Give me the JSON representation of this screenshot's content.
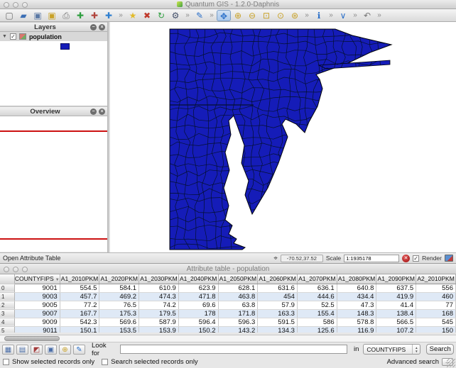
{
  "window": {
    "title": "Quantum GIS - 1.2.0-Daphnis"
  },
  "main_toolbar": {
    "tools": [
      {
        "name": "new-project",
        "glyph": "▢",
        "color": "#6b6b6b"
      },
      {
        "name": "open-project",
        "glyph": "▰",
        "color": "#3b6fb5"
      },
      {
        "name": "save-project",
        "glyph": "▣",
        "color": "#5b79a5"
      },
      {
        "name": "save-project-as",
        "glyph": "▣",
        "color": "#c9a227"
      },
      {
        "name": "print-composer",
        "glyph": "⎙",
        "color": "#777777"
      },
      {
        "name": "add-vector-layer",
        "glyph": "✚",
        "color": "#2e9e3f"
      },
      {
        "name": "add-raster-layer",
        "glyph": "✚",
        "color": "#b0443c"
      },
      {
        "name": "new-vector-layer",
        "glyph": "✚",
        "color": "#2f7fd0"
      },
      {
        "name": "overflow",
        "glyph": "»",
        "color": "#8a8a8a"
      },
      {
        "name": "new-bookmark",
        "glyph": "★",
        "color": "#e2bb2a"
      },
      {
        "name": "remove-layer",
        "glyph": "✖",
        "color": "#c0392b"
      },
      {
        "name": "add-to-overview",
        "glyph": "↻",
        "color": "#2e9e3f"
      },
      {
        "name": "options",
        "glyph": "⚙",
        "color": "#44506b"
      },
      {
        "name": "overflow",
        "glyph": "»",
        "color": "#8a8a8a"
      },
      {
        "name": "edit-pencil",
        "glyph": "✎",
        "color": "#2a6fc9"
      },
      {
        "name": "overflow",
        "glyph": "»",
        "color": "#8a8a8a"
      },
      {
        "name": "pan-map",
        "glyph": "✥",
        "color": "#2a6fc9",
        "active": true
      },
      {
        "name": "zoom-in",
        "glyph": "⊕",
        "color": "#c9a227"
      },
      {
        "name": "zoom-out",
        "glyph": "⊖",
        "color": "#c9a227"
      },
      {
        "name": "zoom-to-selection",
        "glyph": "⊡",
        "color": "#c9a227"
      },
      {
        "name": "zoom-last",
        "glyph": "⊙",
        "color": "#c9a227"
      },
      {
        "name": "zoom-full",
        "glyph": "⊛",
        "color": "#c9a227"
      },
      {
        "name": "overflow",
        "glyph": "»",
        "color": "#8a8a8a"
      },
      {
        "name": "identify-features",
        "glyph": "ℹ",
        "color": "#2a6fc9"
      },
      {
        "name": "overflow",
        "glyph": "»",
        "color": "#8a8a8a"
      },
      {
        "name": "measure-line",
        "glyph": "∨",
        "color": "#2a6fc9"
      },
      {
        "name": "overflow",
        "glyph": "»",
        "color": "#8a8a8a"
      },
      {
        "name": "undo",
        "glyph": "↶",
        "color": "#777777"
      },
      {
        "name": "overflow",
        "glyph": "»",
        "color": "#8a8a8a"
      }
    ]
  },
  "layers_panel": {
    "title": "Layers",
    "layer": {
      "name": "population",
      "checked": "✓"
    }
  },
  "overview_panel": {
    "title": "Overview"
  },
  "map": {
    "fill_color": "#151cb8",
    "outline_color": "#000208",
    "county_line_color": "#04102e"
  },
  "status_bar": {
    "hint": "Open Attribute Table",
    "coordinates": "-70.52,37.52",
    "scale_label": "Scale",
    "scale_value": "1:1935178",
    "render_label": "Render",
    "render_checked": "✓"
  },
  "attribute_table": {
    "title": "Attribute table - population",
    "sort_column": "COUNTYFIPS",
    "columns": [
      "COUNTYFIPS",
      "A1_2010PKM",
      "A1_2020PKM",
      "A1_2030PKM",
      "A1_2040PKM",
      "A1_2050PKM",
      "A1_2060PKM",
      "A1_2070PKM",
      "A1_2080PKM",
      "A1_2090PKM",
      "A2_2010PKM"
    ],
    "rows": [
      [
        "9001",
        "554.5",
        "584.1",
        "610.9",
        "623.9",
        "628.1",
        "631.6",
        "636.1",
        "640.8",
        "637.5",
        "556"
      ],
      [
        "9003",
        "457.7",
        "469.2",
        "474.3",
        "471.8",
        "463.8",
        "454",
        "444.6",
        "434.4",
        "419.9",
        "460"
      ],
      [
        "9005",
        "77.2",
        "76.5",
        "74.2",
        "69.6",
        "63.8",
        "57.9",
        "52.5",
        "47.3",
        "41.4",
        "77"
      ],
      [
        "9007",
        "167.7",
        "175.3",
        "179.5",
        "178",
        "171.8",
        "163.3",
        "155.4",
        "148.3",
        "138.4",
        "168"
      ],
      [
        "9009",
        "542.3",
        "569.6",
        "587.9",
        "596.4",
        "596.3",
        "591.5",
        "586",
        "578.8",
        "566.5",
        "545"
      ],
      [
        "9011",
        "150.1",
        "153.5",
        "153.9",
        "150.2",
        "143.2",
        "134.3",
        "125.6",
        "116.9",
        "107.2",
        "150"
      ]
    ],
    "tools": [
      {
        "name": "unselect-all",
        "glyph": "▦",
        "color": "#4a6da7"
      },
      {
        "name": "move-selection-to-top",
        "glyph": "▤",
        "color": "#4a6da7"
      },
      {
        "name": "invert-selection",
        "glyph": "◩",
        "color": "#a33b3b"
      },
      {
        "name": "copy-selected-rows",
        "glyph": "▣",
        "color": "#4a6da7"
      },
      {
        "name": "zoom-to-selected",
        "glyph": "⊕",
        "color": "#c9a227"
      },
      {
        "name": "toggle-editing",
        "glyph": "✎",
        "color": "#2a6fc9"
      }
    ],
    "search": {
      "look_for_label": "Look for",
      "in_label": "in",
      "field": "COUNTYFIPS",
      "search_button": "Search",
      "advanced_label": "Advanced search",
      "advanced_button": "..."
    },
    "options": {
      "show_selected": "Show selected records only",
      "search_selected": "Search selected records only"
    }
  }
}
